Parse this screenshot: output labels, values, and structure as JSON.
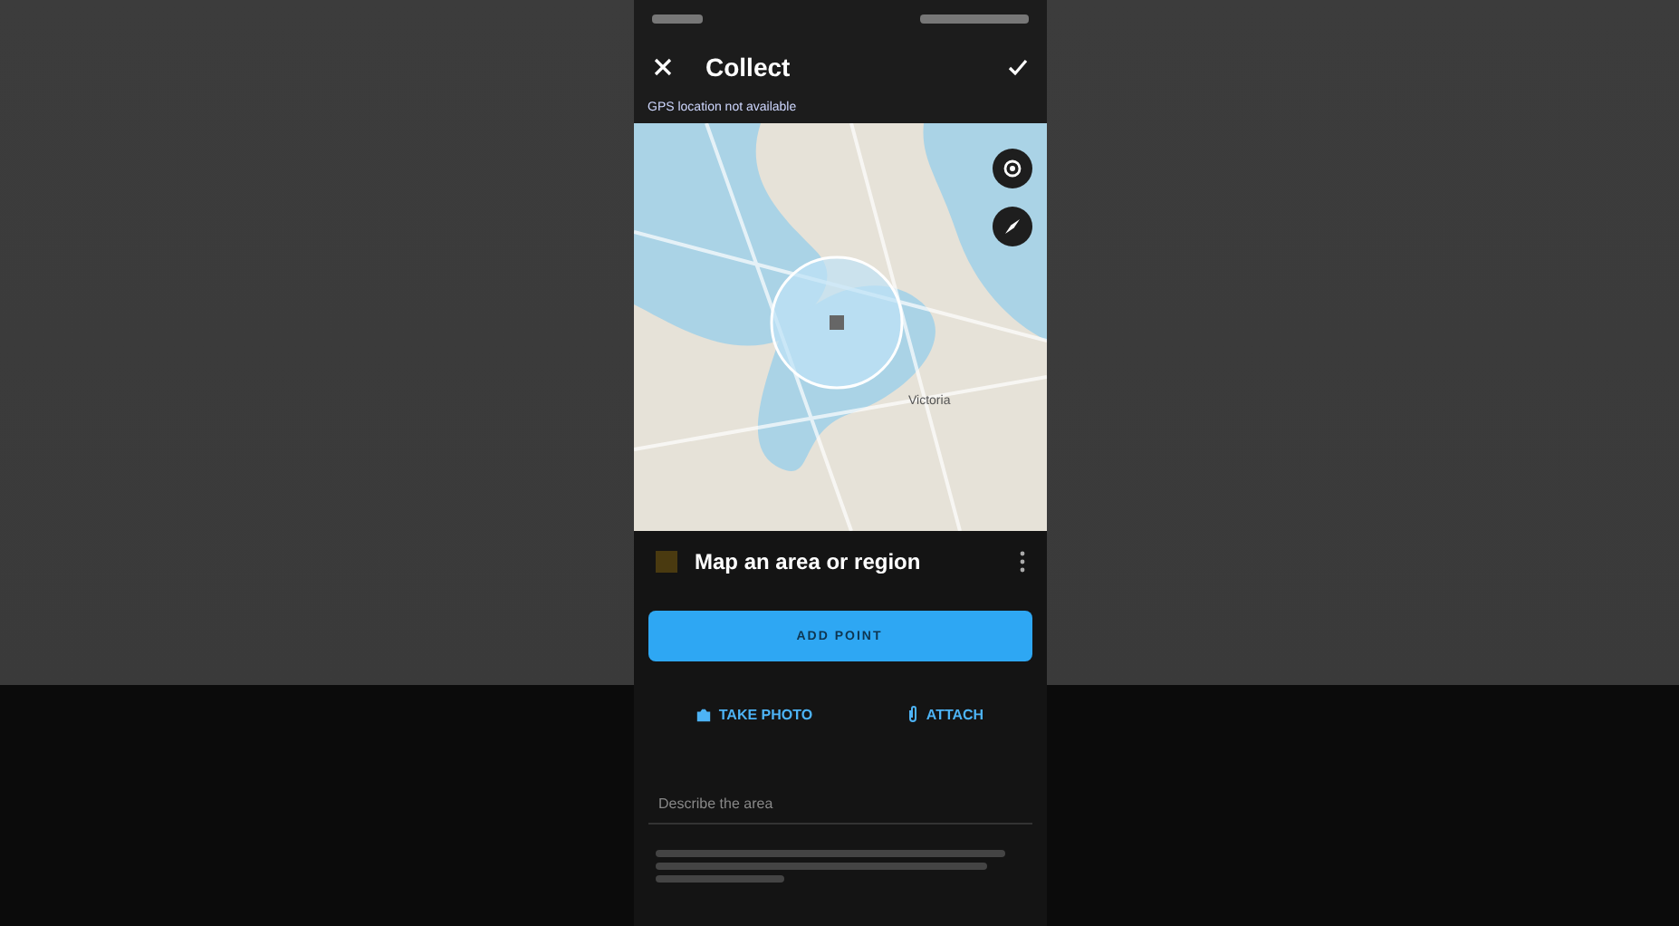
{
  "toolbar": {
    "title": "Collect"
  },
  "banner": {
    "text": "GPS location not available"
  },
  "map": {
    "place_label": "Victoria"
  },
  "sheet": {
    "title": "Map an area or region",
    "primary_button": "ADD POINT",
    "actions": [
      {
        "label": "TAKE PHOTO",
        "kind": "camera"
      },
      {
        "label": "ATTACH",
        "kind": "attach"
      }
    ],
    "description": {
      "placeholder": "Describe the area"
    }
  }
}
